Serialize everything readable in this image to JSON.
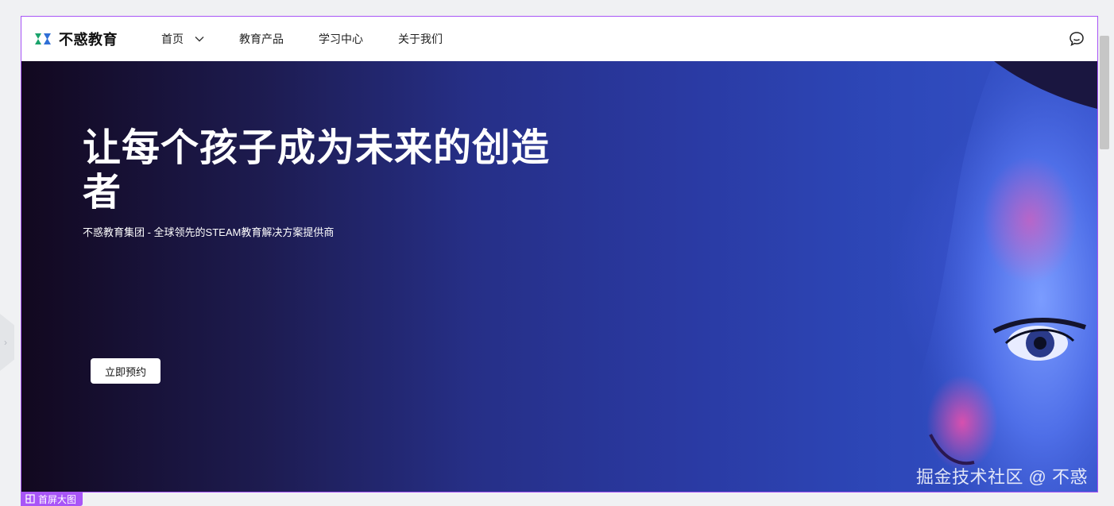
{
  "logo": {
    "text": "不惑教育",
    "icon": "brand-logo-icon"
  },
  "nav": {
    "items": [
      {
        "label": "首页",
        "has_dropdown": true
      },
      {
        "label": "教育产品"
      },
      {
        "label": "学习中心"
      },
      {
        "label": "关于我们"
      }
    ],
    "chat_icon": "chat-bubble-icon"
  },
  "hero": {
    "title": "让每个孩子成为未来的创造者",
    "subtitle": "不惑教育集团 - 全球领先的STEAM教育解决方案提供商",
    "cta_label": "立即预约",
    "watermark": "掘金技术社区 @ 不惑"
  },
  "section_tag": {
    "label": "首屏大图",
    "icon": "layout-icon"
  },
  "colors": {
    "accent": "#a855f7",
    "hero_dark": "#12081f",
    "hero_blue": "#3552c9"
  }
}
